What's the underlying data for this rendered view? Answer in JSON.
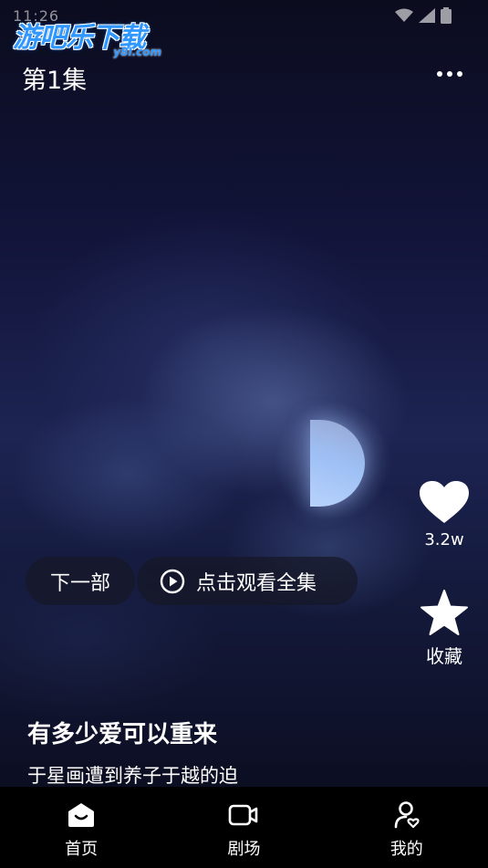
{
  "status_bar": {
    "time": "11:26",
    "icons": [
      "wifi-icon",
      "signal-icon",
      "battery-icon"
    ]
  },
  "watermark": {
    "text": "游吧乐下载",
    "subtext": "y8l.com",
    "color": "#2f97ff"
  },
  "header": {
    "episode_title": "第1集",
    "more_icon": "more-dots-icon"
  },
  "actions": {
    "like_icon": "heart-icon",
    "like_count": "3.2w",
    "favorite_icon": "star-icon",
    "favorite_label": "收藏"
  },
  "pills": {
    "next_label": "下一部",
    "watch_all_label": "点击观看全集",
    "watch_all_icon": "play-circle-icon"
  },
  "drama": {
    "title": "有多少爱可以重来",
    "description": "于星画遭到养子于越的迫"
  },
  "bottom_nav": {
    "items": [
      {
        "label": "首页",
        "icon": "home-icon"
      },
      {
        "label": "剧场",
        "icon": "video-camera-icon"
      },
      {
        "label": "我的",
        "icon": "profile-icon"
      }
    ]
  },
  "colors": {
    "nav_background": "#000000",
    "pill_background": "#161826",
    "accent": "#2f97ff"
  }
}
